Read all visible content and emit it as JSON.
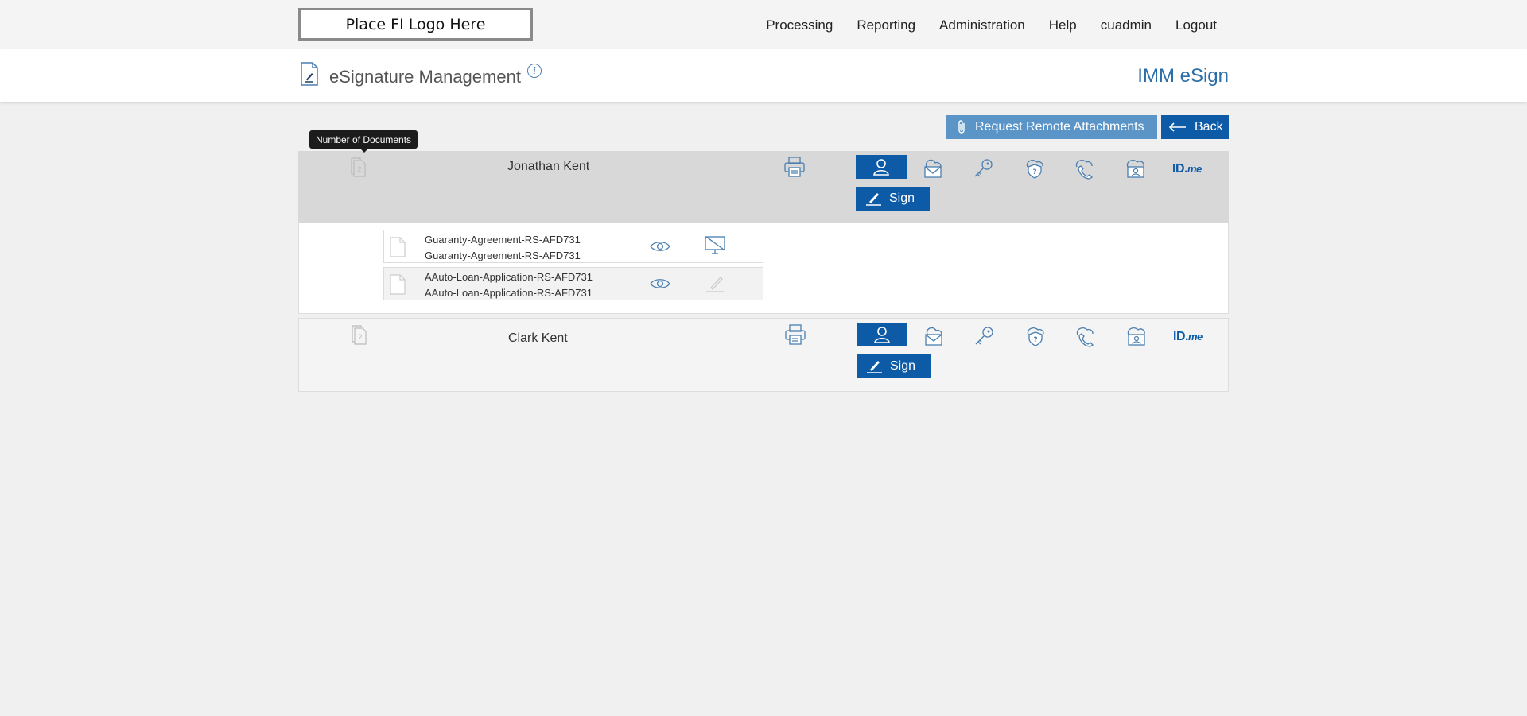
{
  "logo": {
    "text": "Place FI Logo Here"
  },
  "nav": [
    "Processing",
    "Reporting",
    "Administration",
    "Help",
    "cuadmin",
    "Logout"
  ],
  "header": {
    "title": "eSignature Management",
    "info": "i",
    "brand": "IMM eSign"
  },
  "actions": {
    "attach_label": "Request Remote Attachments",
    "back_label": "Back"
  },
  "tooltip": "Number of Documents",
  "signers": [
    {
      "name": "Jonathan Kent",
      "doc_count": "2",
      "sign_label": "Sign",
      "documents": [
        {
          "name": "Guaranty-Agreement-RS-AFD731",
          "subname": "Guaranty-Agreement-RS-AFD731"
        },
        {
          "name": "AAuto-Loan-Application-RS-AFD731",
          "subname": "AAuto-Loan-Application-RS-AFD731"
        }
      ]
    },
    {
      "name": "Clark Kent",
      "doc_count": "2",
      "sign_label": "Sign"
    }
  ],
  "idme": {
    "id": "ID.",
    "me": "me"
  },
  "icons": [
    "document-pen-icon",
    "info-icon",
    "paperclip-icon",
    "arrow-left-icon",
    "documents-count-icon",
    "printer-icon",
    "user-icon",
    "cloud-email-icon",
    "key-icon",
    "shield-question-icon",
    "phone-icon",
    "cloud-id-card-icon",
    "idme-logo",
    "pen-icon",
    "file-icon",
    "eye-icon",
    "monitor-off-icon",
    "pen-disabled-icon"
  ],
  "colors": {
    "primary": "#0d5aa7",
    "accent_light": "#5b95c8",
    "brand_text": "#2b6ea8",
    "signer_header_bg": "#d8d8d8"
  }
}
